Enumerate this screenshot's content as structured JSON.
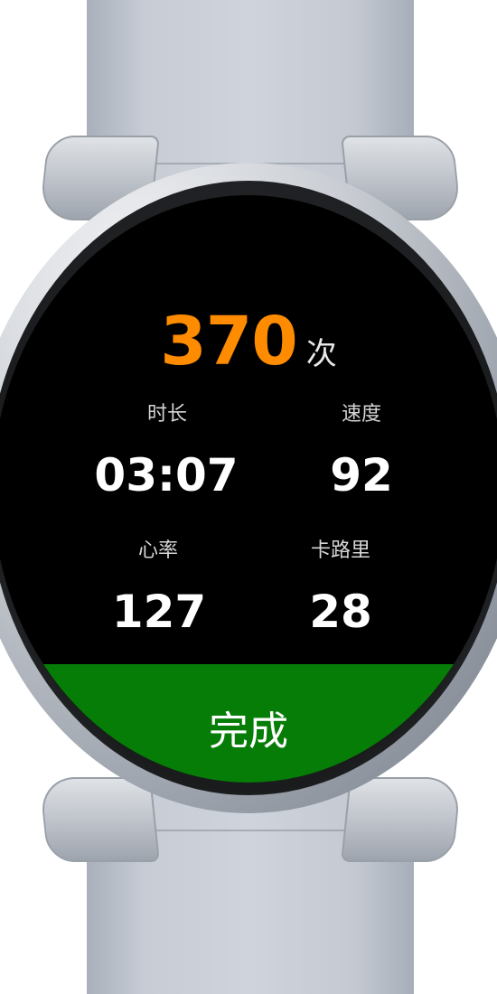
{
  "workout": {
    "count_value": "370",
    "count_unit": "次"
  },
  "stats": [
    {
      "label": "时长",
      "value": "03:07"
    },
    {
      "label": "速度",
      "value": "92"
    },
    {
      "label": "心率",
      "value": "127"
    },
    {
      "label": "卡路里",
      "value": "28"
    }
  ],
  "actions": {
    "done_label": "完成"
  },
  "colors": {
    "accent": "#ff8c00",
    "done_button": "#067d06",
    "screen_bg": "#000000",
    "text_primary": "#ffffff",
    "text_secondary": "#d6d6d6"
  }
}
